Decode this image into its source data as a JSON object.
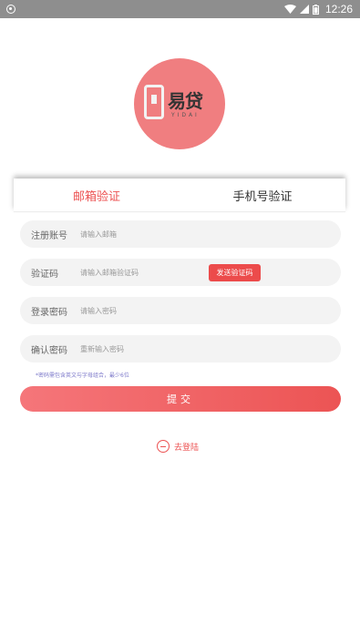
{
  "status_bar": {
    "time": "12:26"
  },
  "logo": {
    "brand_text": "易贷",
    "sub_text": "YIDAI"
  },
  "tabs": [
    {
      "label": "邮箱验证",
      "active": true
    },
    {
      "label": "手机号验证",
      "active": false
    }
  ],
  "form": {
    "account": {
      "label": "注册账号",
      "placeholder": "请输入邮箱"
    },
    "code": {
      "label": "验证码",
      "placeholder": "请输入邮箱验证码",
      "send_button": "发送验证码"
    },
    "password": {
      "label": "登录密码",
      "placeholder": "请输入密码"
    },
    "confirm": {
      "label": "确认密码",
      "placeholder": "重新输入密码"
    },
    "hint": "*密码需包含英文与字母组合，最少6位"
  },
  "submit_label": "提交",
  "login_link": "去登陆",
  "colors": {
    "accent": "#ec5252",
    "logo_circle": "#f07e80",
    "status_bar": "#8e8e8e",
    "field_bg": "#f3f3f3",
    "hint": "#7b77c9"
  }
}
